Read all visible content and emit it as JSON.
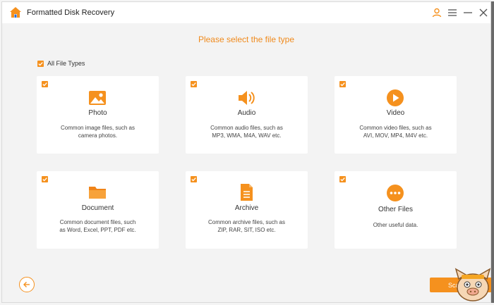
{
  "window": {
    "title": "Formatted Disk Recovery",
    "accent_color": "#f5911e"
  },
  "titlebar": {
    "icons": [
      "home-icon",
      "user-icon",
      "menu-icon",
      "minimize-icon",
      "close-icon"
    ]
  },
  "page": {
    "title": "Please select the file type",
    "all_types_label": "All File Types",
    "all_types_checked": true
  },
  "file_types": [
    {
      "name": "Photo",
      "desc_1": "Common image files, such as",
      "desc_2": "camera photos.",
      "icon": "photo-icon",
      "checked": true
    },
    {
      "name": "Audio",
      "desc_1": "Common audio files, such as",
      "desc_2": "MP3, WMA, M4A, WAV etc.",
      "icon": "audio-icon",
      "checked": true
    },
    {
      "name": "Video",
      "desc_1": "Common video files, such as",
      "desc_2": "AVI, MOV, MP4, M4V etc.",
      "icon": "video-icon",
      "checked": true
    },
    {
      "name": "Document",
      "desc_1": "Common document files, such",
      "desc_2": "as Word, Excel, PPT, PDF etc.",
      "icon": "folder-icon",
      "checked": true
    },
    {
      "name": "Archive",
      "desc_1": "Common archive files, such as",
      "desc_2": "ZIP, RAR, SIT, ISO etc.",
      "icon": "archive-icon",
      "checked": true
    },
    {
      "name": "Other Files",
      "desc_1": "Other useful data.",
      "desc_2": "",
      "icon": "more-icon",
      "checked": true
    }
  ],
  "footer": {
    "scan_label": "Scan"
  }
}
